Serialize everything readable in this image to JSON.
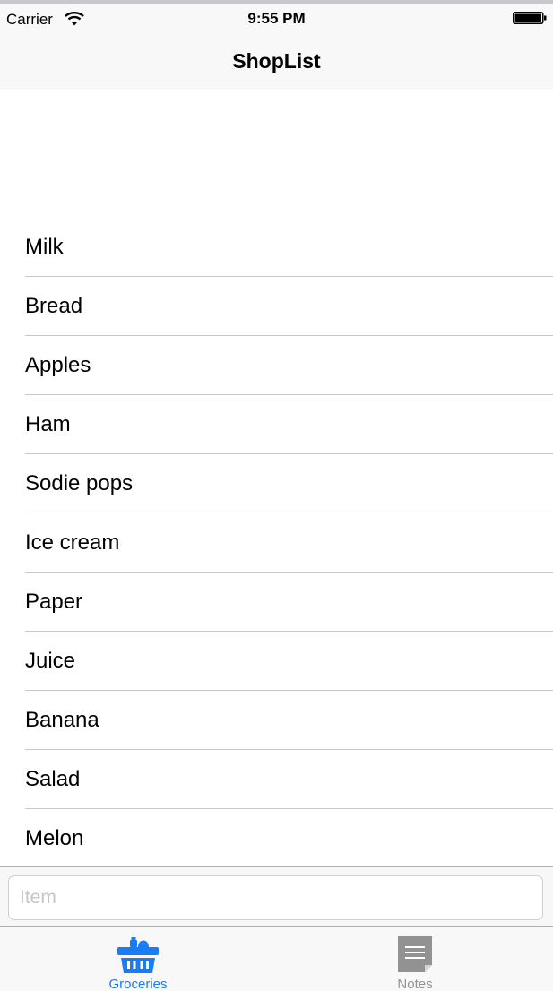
{
  "status_bar": {
    "carrier": "Carrier",
    "time": "9:55 PM"
  },
  "nav": {
    "title": "ShopList"
  },
  "list": {
    "items": [
      {
        "label": "Milk"
      },
      {
        "label": "Bread"
      },
      {
        "label": "Apples"
      },
      {
        "label": "Ham"
      },
      {
        "label": "Sodie pops"
      },
      {
        "label": "Ice cream"
      },
      {
        "label": "Paper"
      },
      {
        "label": "Juice"
      },
      {
        "label": "Banana"
      },
      {
        "label": "Salad"
      },
      {
        "label": "Melon"
      }
    ]
  },
  "input": {
    "placeholder": "Item",
    "value": ""
  },
  "tabs": {
    "groceries": {
      "label": "Groceries",
      "icon": "basket-icon",
      "selected": true
    },
    "notes": {
      "label": "Notes",
      "icon": "notes-icon",
      "selected": false
    }
  },
  "colors": {
    "accent": "#1a7cf5",
    "inactive": "#929292",
    "separator": "#c8c7cc"
  }
}
